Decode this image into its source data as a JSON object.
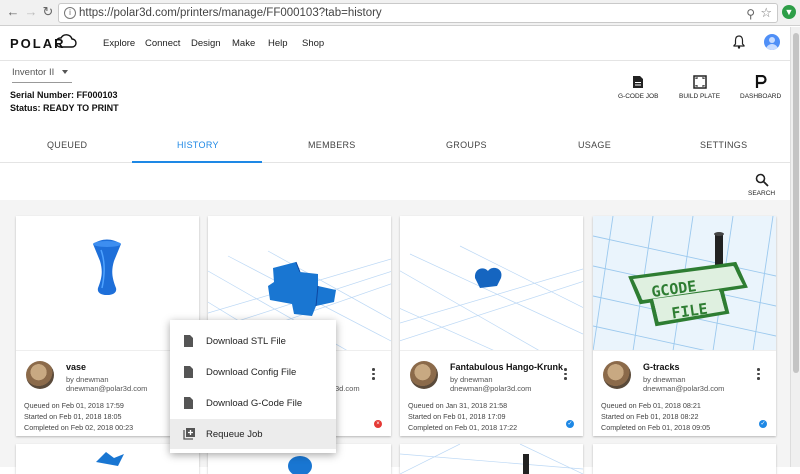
{
  "browser": {
    "url": "https://polar3d.com/printers/manage/FF000103?tab=history"
  },
  "header": {
    "logo": "POLAR",
    "nav": [
      "Explore",
      "Connect",
      "Design",
      "Make",
      "Help",
      "Shop"
    ]
  },
  "printer": {
    "selected": "Inventor II",
    "serial": "Serial Number: FF000103",
    "status": "Status: READY TO PRINT"
  },
  "actions": {
    "gcode": "G-CODE JOB",
    "buildplate": "BUILD PLATE",
    "dashboard": "DASHBOARD"
  },
  "tabs": [
    "QUEUED",
    "HISTORY",
    "MEMBERS",
    "GROUPS",
    "USAGE",
    "SETTINGS"
  ],
  "search_label": "SEARCH",
  "cards": [
    {
      "title": "vase",
      "by": "by dnewman",
      "email": "dnewman@polar3d.com",
      "queued": "Queued on Feb 01, 2018 17:59",
      "started": "Started on Feb 01, 2018 18:05",
      "completed": "Completed on Feb 02, 2018 00:23",
      "status": "error"
    },
    {
      "title": "",
      "by": "",
      "email": "3d.com",
      "queued": "",
      "started": "",
      "completed": "",
      "status": "error"
    },
    {
      "title": "Fantabulous Hango-Krunk",
      "by": "by dnewman",
      "email": "dnewman@polar3d.com",
      "queued": "Queued on Jan 31, 2018 21:58",
      "started": "Started on Feb 01, 2018 17:09",
      "completed": "Completed on Feb 01, 2018 17:22",
      "status": "ok"
    },
    {
      "title": "G-tracks",
      "by": "by dnewman",
      "email": "dnewman@polar3d.com",
      "queued": "Queued on Feb 01, 2018 08:21",
      "started": "Started on Feb 01, 2018 08:22",
      "completed": "Completed on Feb 01, 2018 09:05",
      "status": "ok"
    }
  ],
  "context_menu": [
    "Download STL File",
    "Download Config File",
    "Download G-Code File",
    "Requeue Job"
  ],
  "colors": {
    "accent": "#1e88e5",
    "model": "#1565c0",
    "error": "#e53935"
  }
}
